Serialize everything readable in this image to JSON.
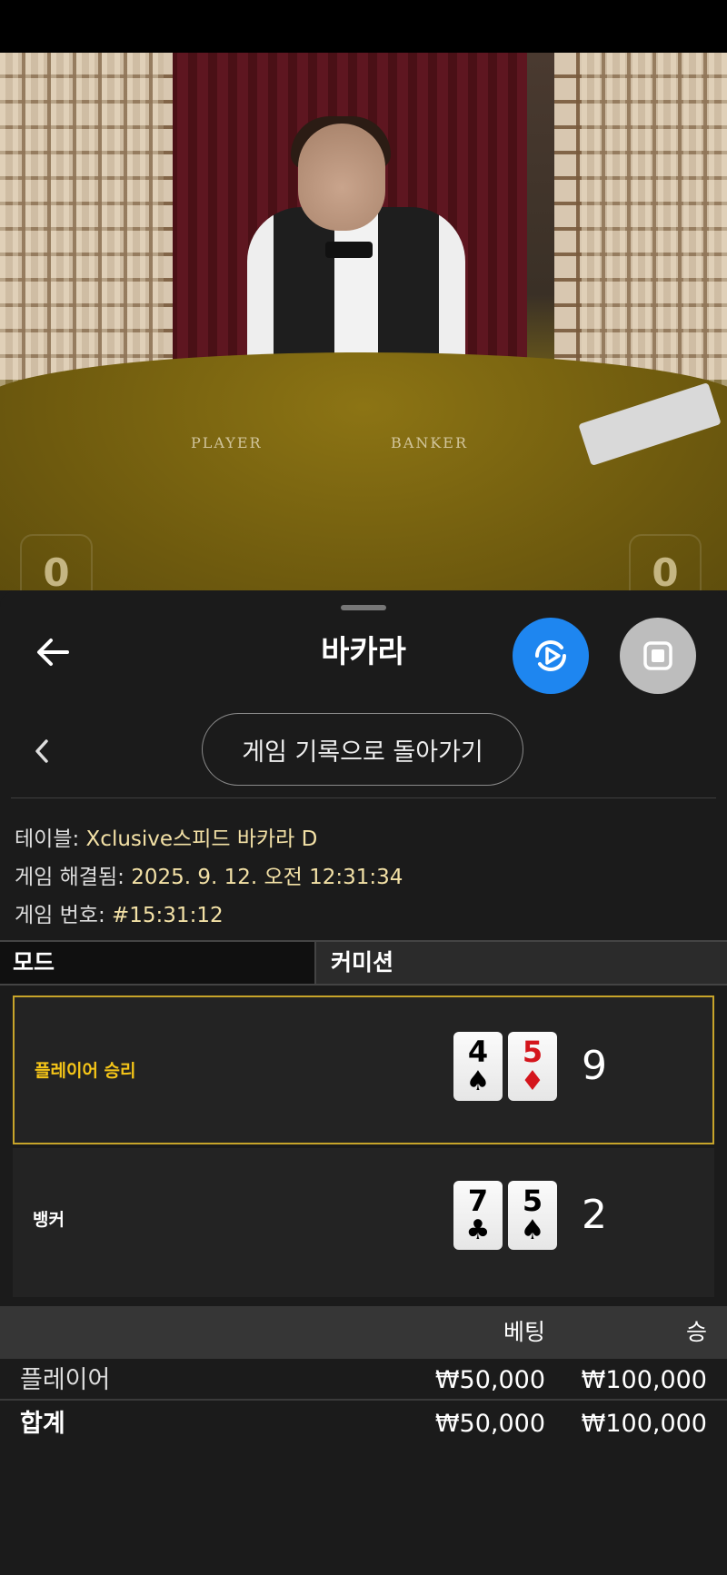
{
  "video": {
    "table_labels": {
      "player": "PLAYER",
      "banker": "BANKER"
    },
    "scores": {
      "player": "0",
      "banker": "0"
    }
  },
  "header": {
    "title": "바카라",
    "back_icon": "arrow-left-icon",
    "live_icon": "live-stream-icon",
    "stop_icon": "stop-icon"
  },
  "nav": {
    "history_button": "게임 기록으로 돌아가기",
    "prev_icon": "chevron-left-icon"
  },
  "info": {
    "table_label": "테이블:",
    "table_value": "Xclusive스피드 바카라 D",
    "resolved_label": "게임 해결됨:",
    "resolved_value": "2025. 9. 12. 오전 12:31:34",
    "number_label": "게임 번호:",
    "number_value": "#15:31:12"
  },
  "mode": {
    "label": "모드",
    "value": "커미션"
  },
  "hands": {
    "player": {
      "label": "플레이어 승리",
      "cards": [
        {
          "rank": "4",
          "suit": "♠",
          "color": "black"
        },
        {
          "rank": "5",
          "suit": "♦",
          "color": "red"
        }
      ],
      "score": "9"
    },
    "banker": {
      "label": "뱅커",
      "cards": [
        {
          "rank": "7",
          "suit": "♣",
          "color": "black"
        },
        {
          "rank": "5",
          "suit": "♠",
          "color": "black"
        }
      ],
      "score": "2"
    }
  },
  "bets": {
    "headers": {
      "bet": "베팅",
      "win": "승"
    },
    "rows": [
      {
        "name": "플레이어",
        "bet": "₩50,000",
        "win": "₩100,000"
      }
    ],
    "total": {
      "name": "합계",
      "bet": "₩50,000",
      "win": "₩100,000"
    }
  },
  "colors": {
    "accent": "#1e86f0",
    "win_border": "#c7a42a",
    "win_label": "#f5c518",
    "value_text": "#f3e1a6"
  }
}
